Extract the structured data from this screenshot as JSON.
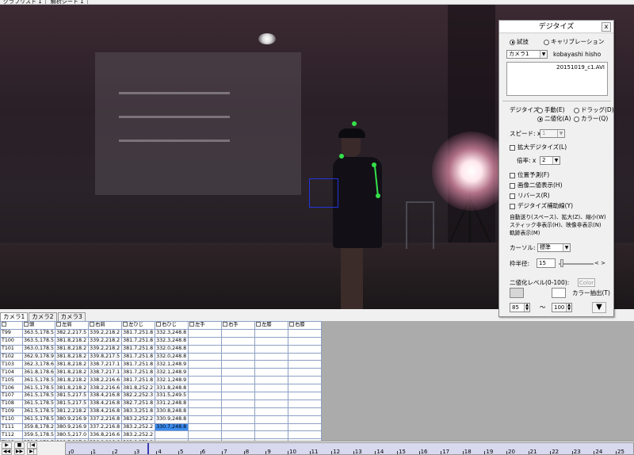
{
  "top_tabs": [
    "グラフリスト 1",
    "解析シート 1"
  ],
  "panel": {
    "title": "デジタイズ",
    "close": "x",
    "mode_trial": "試技",
    "mode_calibration": "キャリブレーション",
    "camera_select": "カメラ1",
    "subject": "kobayashi hisho",
    "file": "20151019_c1.AVI",
    "digitize_label": "デジタイズ:",
    "manual": "手動(E)",
    "drag": "ドラッグ(D)",
    "binary": "二値化(A)",
    "color": "カラー(Q)",
    "speed_label": "スピード: x",
    "speed_value": "1",
    "zoom_digitize": "拡大デジタイズ(L)",
    "magnification_label": "倍率: x",
    "magnification_value": "2",
    "position_predict": "位置予測(F)",
    "binary_display": "画像二値表示(H)",
    "reverse": "リバース(R)",
    "aux_lines": "デジタイズ補助線(Y)",
    "help_text": [
      "自動送り(スペース)、拡大(Z)、縮小(W)",
      "スティック非表示(H)、映像非表示(N)",
      "軌跡表示(M)"
    ],
    "cursor_label": "カーソル:",
    "cursor_value": "標準",
    "frame_radius_label": "枠半径:",
    "frame_radius_value": "15",
    "slider_arrows": "< >",
    "binary_level_label": "二値化レベル(0-100):",
    "color_button": "Color",
    "color_extract": "カラー抽出(T)",
    "level_low": "85",
    "level_sep": "～",
    "level_high": "100",
    "expand_button": "▼"
  },
  "camera_tabs": [
    "カメラ1",
    "カメラ2",
    "カメラ3"
  ],
  "columns": [
    "頭",
    "左肩",
    "右肩",
    "左ひじ",
    "右ひじ",
    "左手",
    "右手",
    "左膝",
    "右膝"
  ],
  "rows": [
    {
      "label": "T99",
      "cells": [
        "363.5,178.5",
        "382.2,217.5",
        "339.2,218.2",
        "381.7,251.8",
        "332.3,248.8",
        "",
        "",
        "",
        ""
      ]
    },
    {
      "label": "T100",
      "cells": [
        "363.5,178.5",
        "381.8,218.2",
        "339.2,218.2",
        "381.7,251.8",
        "332.3,248.8",
        "",
        "",
        "",
        ""
      ]
    },
    {
      "label": "T101",
      "cells": [
        "363.0,178.5",
        "381.8,218.2",
        "339.2,218.2",
        "381.7,251.8",
        "332.0,248.8",
        "",
        "",
        "",
        ""
      ]
    },
    {
      "label": "T102",
      "cells": [
        "362.9,178.9",
        "381.8,218.2",
        "339.8,217.5",
        "381.7,251.8",
        "332.0,248.8",
        "",
        "",
        "",
        ""
      ]
    },
    {
      "label": "T103",
      "cells": [
        "362.3,178.6",
        "381.8,218.2",
        "338.7,217.1",
        "381.7,251.8",
        "332.1,248.9",
        "",
        "",
        "",
        ""
      ]
    },
    {
      "label": "T104",
      "cells": [
        "361.8,178.6",
        "381.8,218.2",
        "338.7,217.1",
        "381.7,251.8",
        "332.1,248.9",
        "",
        "",
        "",
        ""
      ]
    },
    {
      "label": "T105",
      "cells": [
        "361.5,178.5",
        "381.8,218.2",
        "338.2,216.6",
        "381.7,251.8",
        "332.1,248.9",
        "",
        "",
        "",
        ""
      ]
    },
    {
      "label": "T106",
      "cells": [
        "361.5,178.5",
        "381.8,218.2",
        "338.2,216.6",
        "381.8,252.2",
        "331.8,248.8",
        "",
        "",
        "",
        ""
      ]
    },
    {
      "label": "T107",
      "cells": [
        "361.5,178.5",
        "381.5,217.5",
        "338.4,216.8",
        "382.2,252.3",
        "331.5,249.5",
        "",
        "",
        "",
        ""
      ]
    },
    {
      "label": "T108",
      "cells": [
        "361.5,178.5",
        "381.5,217.5",
        "338.4,216.8",
        "382.7,251.8",
        "331.2,248.8",
        "",
        "",
        "",
        ""
      ]
    },
    {
      "label": "T109",
      "cells": [
        "361.5,178.5",
        "381.2,218.2",
        "338.4,216.8",
        "383.3,251.8",
        "330.8,248.8",
        "",
        "",
        "",
        ""
      ]
    },
    {
      "label": "T110",
      "cells": [
        "361.5,178.5",
        "380.9,216.9",
        "337.2,216.8",
        "383.2,252.2",
        "330.9,248.8",
        "",
        "",
        "",
        ""
      ]
    },
    {
      "label": "T111",
      "cells": [
        "359.8,178.2",
        "380.9,216.9",
        "337.2,216.8",
        "383.2,252.2",
        "330.7,248.8",
        "",
        "",
        "",
        ""
      ]
    },
    {
      "label": "T112",
      "cells": [
        "359.5,178.5",
        "380.5,217.0",
        "336.8,216.6",
        "383.2,252.2",
        "",
        "",
        "",
        "",
        ""
      ]
    },
    {
      "label": "T113",
      "cells": [
        "359.5,178.5",
        "380.5,217.0",
        "336.8,216.6",
        "383.8,252.2",
        "",
        "",
        "",
        "",
        ""
      ]
    }
  ],
  "timeline": {
    "ticks": [
      "0",
      "1",
      "2",
      "3",
      "4",
      "5",
      "6",
      "7",
      "8",
      "9",
      "10",
      "11",
      "12",
      "13",
      "14",
      "15",
      "16",
      "17",
      "18",
      "19",
      "20",
      "21",
      "22",
      "23",
      "24",
      "25"
    ],
    "buttons": [
      "▶",
      "■",
      "|◀",
      "◀◀",
      "▶▶",
      "▶|"
    ]
  }
}
